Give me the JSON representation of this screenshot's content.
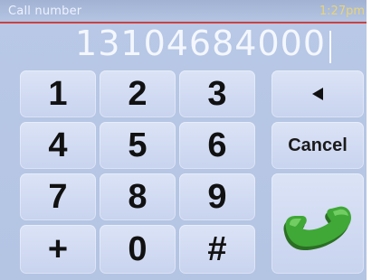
{
  "status": {
    "title": "Call number",
    "time": "1:27pm"
  },
  "display": {
    "number": "13104684000"
  },
  "keypad": {
    "keys": [
      "1",
      "2",
      "3",
      "4",
      "5",
      "6",
      "7",
      "8",
      "9",
      "+",
      "0",
      "#"
    ]
  },
  "actions": {
    "cancel_label": "Cancel",
    "backspace_icon": "backspace-arrow-icon",
    "call_icon": "phone-handset-icon"
  },
  "colors": {
    "background": "#b8c8e6",
    "key": "#d3dcf2",
    "time": "#e8d478",
    "accent_line": "#c94242",
    "call_green": "#3fa836"
  }
}
